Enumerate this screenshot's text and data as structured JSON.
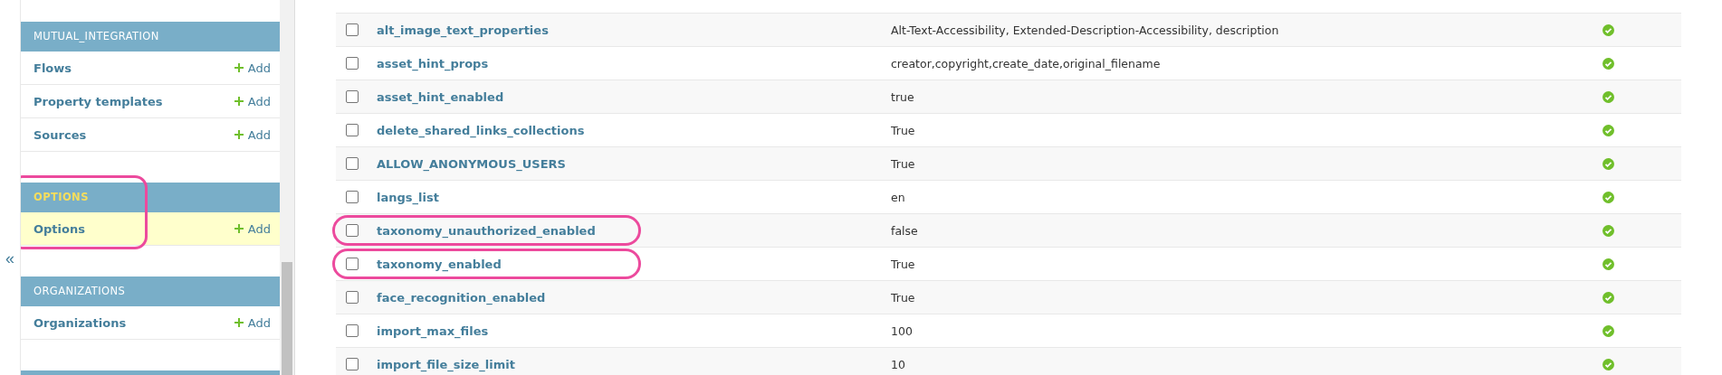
{
  "sidebar": {
    "toggle": "«",
    "sections": [
      {
        "caption": "MUTUAL_INTEGRATION",
        "selected": false,
        "circled": false,
        "models": [
          {
            "name": "Flows",
            "add": "Add",
            "selected": false
          },
          {
            "name": "Property templates",
            "add": "Add",
            "selected": false
          },
          {
            "name": "Sources",
            "add": "Add",
            "selected": false
          }
        ]
      },
      {
        "caption": "OPTIONS",
        "selected": true,
        "circled": true,
        "models": [
          {
            "name": "Options",
            "add": "Add",
            "selected": true
          }
        ]
      },
      {
        "caption": "ORGANIZATIONS",
        "selected": false,
        "circled": false,
        "models": [
          {
            "name": "Organizations",
            "add": "Add",
            "selected": false
          }
        ]
      }
    ]
  },
  "table": {
    "rows": [
      {
        "name": "alt_image_text_properties",
        "value": "Alt-Text-Accessibility, Extended-Description-Accessibility, description",
        "checked": false,
        "active": true,
        "circled": false
      },
      {
        "name": "asset_hint_props",
        "value": "creator,copyright,create_date,original_filename",
        "checked": false,
        "active": true,
        "circled": false
      },
      {
        "name": "asset_hint_enabled",
        "value": "true",
        "checked": false,
        "active": true,
        "circled": false
      },
      {
        "name": "delete_shared_links_collections",
        "value": "True",
        "checked": false,
        "active": true,
        "circled": false
      },
      {
        "name": "ALLOW_ANONYMOUS_USERS",
        "value": "True",
        "checked": false,
        "active": true,
        "circled": false
      },
      {
        "name": "langs_list",
        "value": "en",
        "checked": false,
        "active": true,
        "circled": false
      },
      {
        "name": "taxonomy_unauthorized_enabled",
        "value": "false",
        "checked": false,
        "active": true,
        "circled": true
      },
      {
        "name": "taxonomy_enabled",
        "value": "True",
        "checked": false,
        "active": true,
        "circled": true
      },
      {
        "name": "face_recognition_enabled",
        "value": "True",
        "checked": false,
        "active": true,
        "circled": false
      },
      {
        "name": "import_max_files",
        "value": "100",
        "checked": false,
        "active": true,
        "circled": false
      },
      {
        "name": "import_file_size_limit",
        "value": "10",
        "checked": false,
        "active": true,
        "circled": false
      }
    ]
  }
}
